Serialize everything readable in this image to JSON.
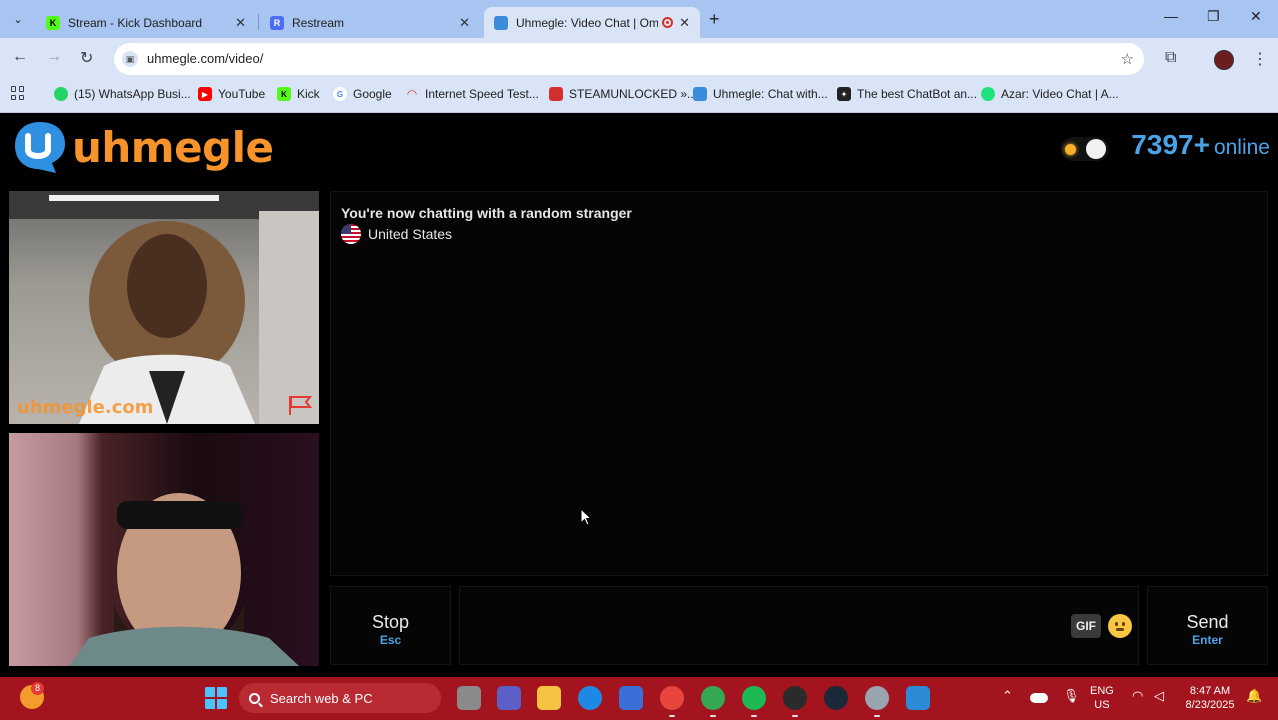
{
  "browser": {
    "tabs": [
      {
        "title": "Stream - Kick Dashboard",
        "favicon": "kick-icon",
        "color": "#53fc18"
      },
      {
        "title": "Restream",
        "favicon": "restream-icon",
        "color": "#4a6cf7"
      },
      {
        "title": "Uhmegle: Video Chat | Ome",
        "favicon": "uhmegle-icon",
        "color": "#3b8ddc",
        "active": true
      }
    ],
    "url": "uhmegle.com/video/",
    "bookmarks": [
      {
        "label": "(15) WhatsApp Busi...",
        "icon": "whatsapp-icon",
        "color": "#25d366"
      },
      {
        "label": "YouTube",
        "icon": "youtube-icon",
        "color": "#ff0000"
      },
      {
        "label": "Kick",
        "icon": "kick-icon",
        "color": "#53fc18"
      },
      {
        "label": "Google",
        "icon": "google-icon",
        "color": "#4285f4"
      },
      {
        "label": "Internet Speed Test...",
        "icon": "speedtest-icon",
        "color": "#e03c5a"
      },
      {
        "label": "STEAMUNLOCKED »...",
        "icon": "steamunlocked-icon",
        "color": "#d32f2f"
      },
      {
        "label": "Uhmegle: Chat with...",
        "icon": "uhmegle-icon",
        "color": "#3b8ddc"
      },
      {
        "label": "The best ChatBot an...",
        "icon": "chatbot-icon",
        "color": "#222222"
      },
      {
        "label": "Azar: Video Chat | A...",
        "icon": "azar-icon",
        "color": "#1ee37a"
      }
    ]
  },
  "site": {
    "logo_text": "uhmegle",
    "online_count": "7397+",
    "online_label": "online",
    "watermark": "uhmegle.com",
    "chat": {
      "status": "You're now chatting with a random stranger",
      "country": "United States"
    },
    "stop": {
      "label": "Stop",
      "shortcut": "Esc"
    },
    "send": {
      "label": "Send",
      "shortcut": "Enter"
    },
    "gif_label": "GIF",
    "accent_color": "#4aa3e8",
    "brand_color": "#f6932b"
  },
  "taskbar": {
    "search_placeholder": "Search web & PC",
    "notification_badge": "8",
    "lang_1": "ENG",
    "lang_2": "US",
    "time": "8:47 AM",
    "date": "8/23/2025"
  }
}
